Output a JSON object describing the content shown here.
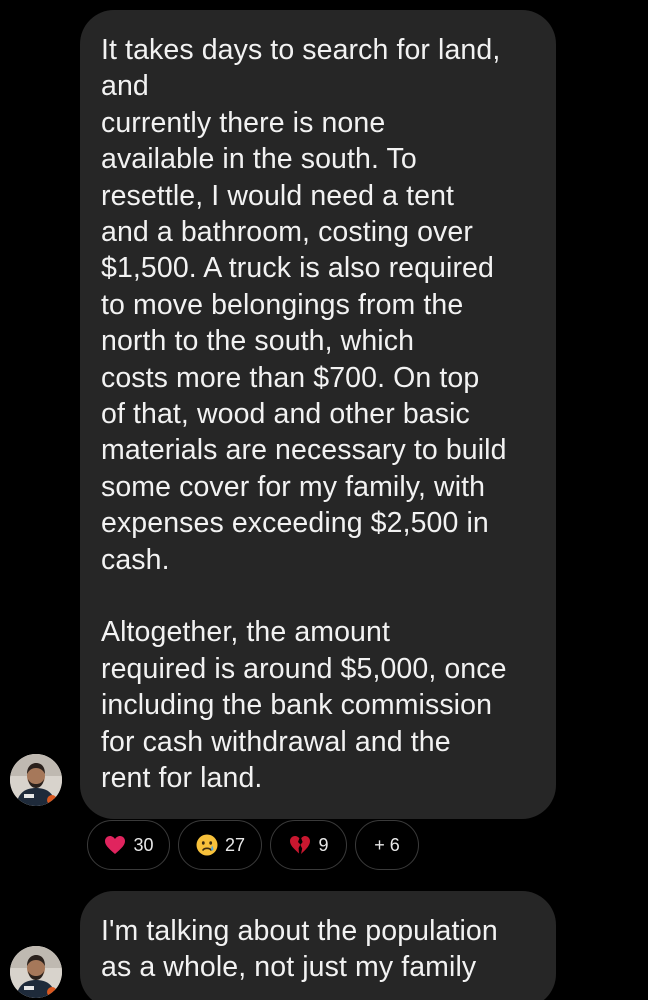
{
  "messages": [
    {
      "paragraphs": [
        [
          "It takes days to search for land,",
          "and",
          "currently there is none",
          "available in the south. To",
          "resettle, I would need a tent",
          "and a bathroom, costing over",
          "$1,500. A truck is also required",
          "to move belongings from the",
          "north to the south, which",
          "costs more than $700. On top",
          "of that, wood and other basic",
          "materials are necessary to build",
          "some cover for my family, with",
          "expenses exceeding $2,500 in",
          "cash."
        ],
        [
          "Altogether, the amount",
          "required is around $5,000, once",
          "including the bank commission",
          "for cash withdrawal and the",
          "rent for land."
        ]
      ]
    },
    {
      "paragraphs": [
        [
          "I'm talking about the population",
          "as a whole, not just my family"
        ]
      ]
    }
  ],
  "reactions": [
    {
      "icon": "red-heart-icon",
      "count": "30"
    },
    {
      "icon": "crying-face-icon",
      "count": "27"
    },
    {
      "icon": "broken-heart-icon",
      "count": "9"
    },
    {
      "icon": "more-reactions",
      "count": "+ 6"
    }
  ],
  "colors": {
    "background": "#000000",
    "bubble": "#262626",
    "text": "#f2f2f2",
    "heart": "#e0245e"
  }
}
